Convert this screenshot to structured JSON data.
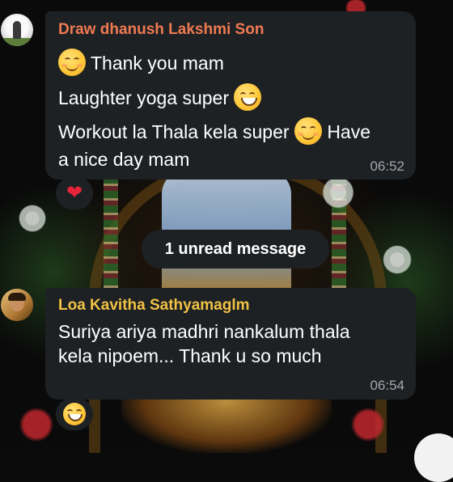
{
  "messages": [
    {
      "sender": "Draw dhanush Lakshmi Son",
      "sender_color": "#ef7a52",
      "lines": [
        "Thank you mam",
        "Laughter yoga super",
        "Workout la Thala kela super",
        "Have",
        "a nice day mam"
      ],
      "time": "06:52",
      "reaction": "heart"
    },
    {
      "sender": "Loa Kavitha Sathyamaglm",
      "sender_color": "#f0c245",
      "lines": [
        "Suriya ariya madhri nankalum thala",
        "kela nipoem... Thank u so much"
      ],
      "time": "06:54",
      "reaction": "face-with-tears-of-joy"
    }
  ],
  "unread_banner": "1 unread message",
  "colors": {
    "bubble": "#1e2124",
    "timestamp": "#a1a7ad",
    "heart": "#e6243a"
  }
}
